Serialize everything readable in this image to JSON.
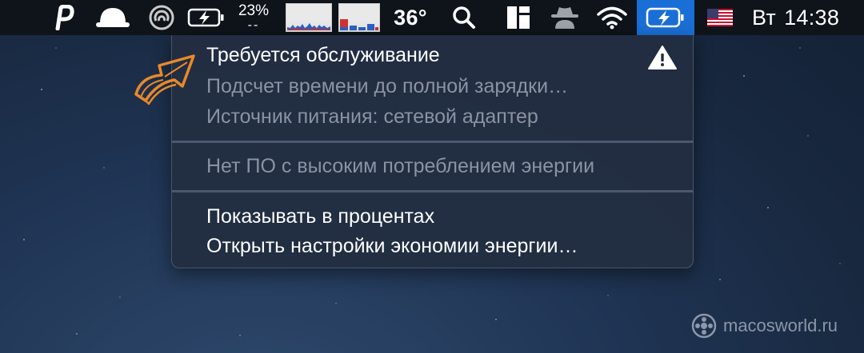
{
  "menubar": {
    "cpu": {
      "percent": "23%",
      "sub": "--"
    },
    "temperature": "36°",
    "input_source": "us-flag-icon",
    "clock": {
      "day": "Вт",
      "time": "14:38"
    }
  },
  "battery_menu": {
    "items": [
      {
        "label": "Требуется обслуживание",
        "enabled": true
      },
      {
        "label": "Подсчет времени до полной зарядки…",
        "enabled": false
      },
      {
        "label": "Источник питания: сетевой адаптер",
        "enabled": false
      },
      {
        "label": "Нет ПО с высоким потреблением энергии",
        "enabled": false
      },
      {
        "label": "Показывать в процентах",
        "enabled": true
      },
      {
        "label": "Открыть настройки экономии энергии…",
        "enabled": true
      }
    ],
    "warning_icon": "warning-triangle-icon"
  },
  "annotation": {
    "icon": "pointer-arrow-icon",
    "color": "#e8892b"
  },
  "watermark": {
    "text": "macosworld.ru"
  },
  "colors": {
    "menubar_bg": "#0f141b",
    "menu_bg": "#222e42",
    "active_item": "#1a6fd6",
    "disabled_text": "#8a93a3"
  }
}
